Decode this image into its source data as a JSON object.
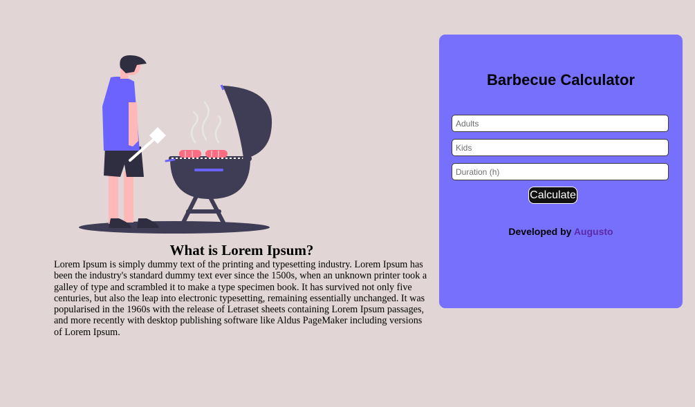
{
  "article": {
    "title": "What is Lorem Ipsum?",
    "body": "Lorem Ipsum is simply dummy text of the printing and typesetting industry. Lorem Ipsum has been the industry's standard dummy text ever since the 1500s, when an unknown printer took a galley of type and scrambled it to make a type specimen book. It has survived not only five centuries, but also the leap into electronic typesetting, remaining essentially unchanged. It was popularised in the 1960s with the release of Letraset sheets containing Lorem Ipsum passages, and more recently with desktop publishing software like Aldus PageMaker including versions of Lorem Ipsum."
  },
  "calculator": {
    "title": "Barbecue Calculator",
    "adults": {
      "value": "",
      "placeholder": "Adults"
    },
    "kids": {
      "value": "",
      "placeholder": "Kids"
    },
    "duration": {
      "value": "",
      "placeholder": "Duration (h)"
    },
    "button_label": "Calculate"
  },
  "footer": {
    "prefix": "Developed by ",
    "author": "Augusto"
  },
  "colors": {
    "background": "#e2d5d5",
    "card": "#7670fd",
    "accent": "#6c63ff",
    "dark": "#3f3d56",
    "meat": "#ff6b81",
    "author_link": "#5a2aa7"
  },
  "illustration": {
    "name": "barbecue-illustration"
  }
}
